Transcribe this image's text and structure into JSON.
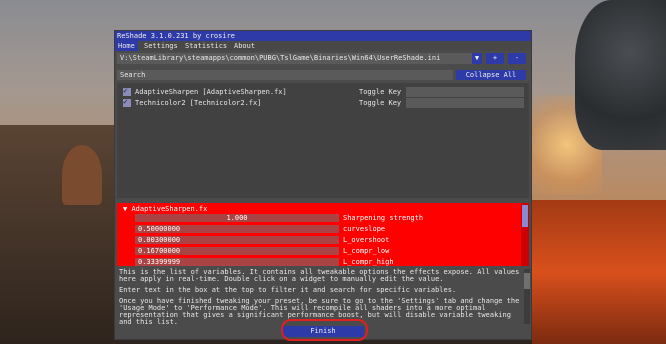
{
  "window": {
    "title": "ReShade 3.1.0.231 by crosire"
  },
  "menu": [
    {
      "label": "Home",
      "active": true
    },
    {
      "label": "Settings",
      "active": false
    },
    {
      "label": "Statistics",
      "active": false
    },
    {
      "label": "About",
      "active": false
    }
  ],
  "preset": {
    "path": "V:\\SteamLibrary\\steamapps\\common\\PUBG\\TslGame\\Binaries\\Win64\\UserReShade.ini",
    "dropdown_icon": "triangle-down-icon",
    "add_label": "+",
    "remove_label": "-"
  },
  "search": {
    "placeholder": "Search",
    "collapse_label": "Collapse All"
  },
  "effects": [
    {
      "name": "AdaptiveSharpen [AdaptiveSharpen.fx]",
      "enabled": true,
      "toggle_label": "Toggle Key",
      "toggle_value": ""
    },
    {
      "name": "Technicolor2 [Technicolor2.fx]",
      "enabled": true,
      "toggle_label": "Toggle Key",
      "toggle_value": ""
    }
  ],
  "variables": {
    "header": "AdaptiveSharpen.fx",
    "items": [
      {
        "value": "1.000",
        "name": "Sharpening strength"
      },
      {
        "value": "0.50000000",
        "name": "curveslope"
      },
      {
        "value": "0.00300000",
        "name": "L_overshoot"
      },
      {
        "value": "0.16700000",
        "name": "L_compr_low"
      },
      {
        "value": "0.33399999",
        "name": "L_compr_high"
      }
    ]
  },
  "help": {
    "p1": "This is the list of variables. It contains all tweakable options the effects expose. All values here apply in real-time. Double click on a widget to manually edit the value.",
    "p2": "Enter text in the box at the top to filter it and search for specific variables.",
    "p3": "Once you have finished tweaking your preset, be sure to go to the 'Settings' tab and change the 'Usage Mode' to 'Performance Mode'. This will recompile all shaders into a more optimal representation that gives a significant performance boost, but will disable variable tweaking and this list."
  },
  "finish": {
    "label": "Finish"
  },
  "colors": {
    "accent": "#2e3aa8",
    "variables_panel": "#ff0000",
    "highlight_ring": "#e02020"
  }
}
